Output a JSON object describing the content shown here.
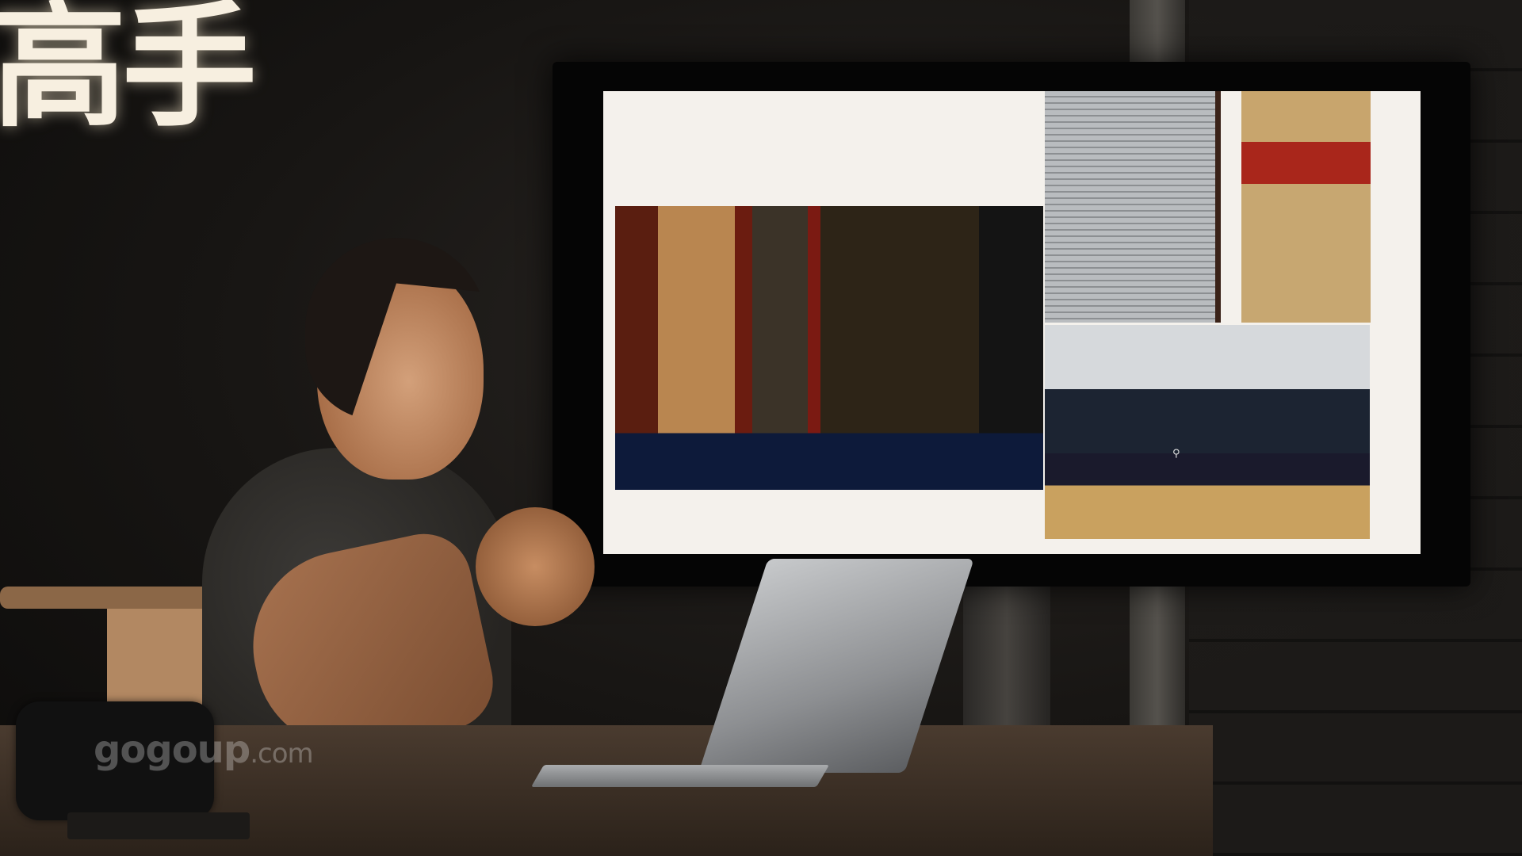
{
  "banner": {
    "text": "高手"
  },
  "watermark": {
    "brand": "gogoup",
    "suffix": ".com"
  },
  "laptop": {
    "logo_icon": "apple-logo-icon",
    "logo_glyph": ""
  },
  "screen": {
    "zoom_icon": "search-icon",
    "zoom_glyph": "⚲"
  },
  "colors": {
    "banner_text": "#f7efe0",
    "screen_bg": "#f4f1ec",
    "accent_red": "#a9261b"
  }
}
